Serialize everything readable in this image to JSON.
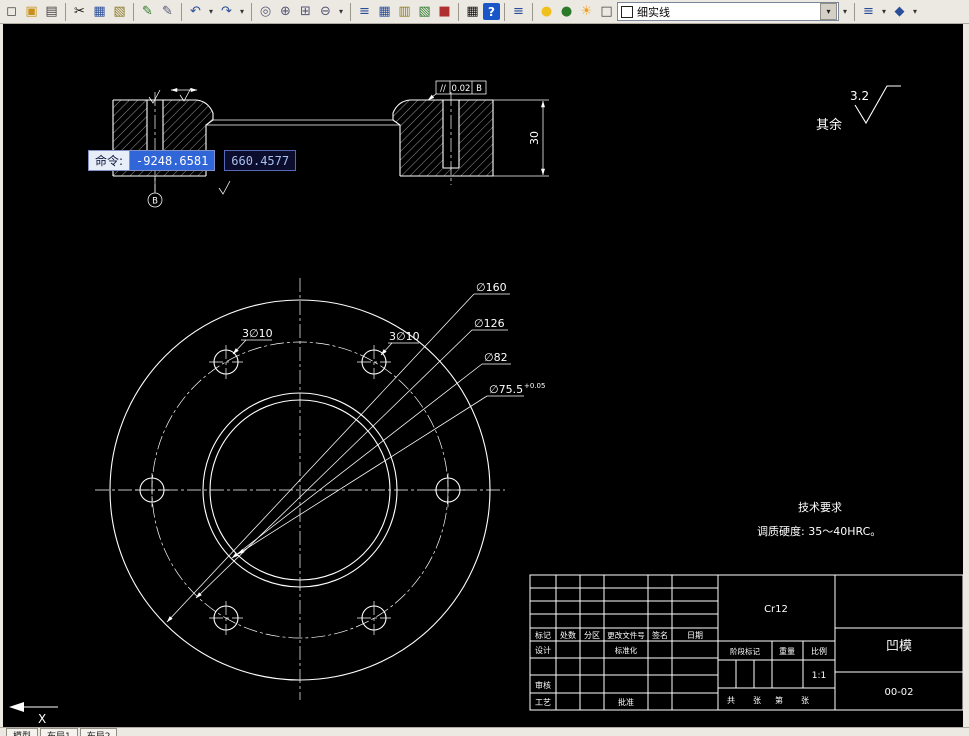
{
  "toolbar": {
    "linetype": "细实线",
    "glyphs": {
      "new": "◻",
      "open": "▣",
      "plot": "▤",
      "cut": "✂",
      "copy": "▦",
      "paste": "▧",
      "brush": "✎",
      "erase": "▨",
      "pencil": "✎",
      "undo": "↶",
      "redo": "↷",
      "caret": "▾",
      "pan": "◎",
      "zoom_in": "⊕",
      "zoom_window": "⊞",
      "zoom_prev": "⊖",
      "layers": "≡",
      "layer_props": "▦",
      "props": "▥",
      "design_center": "▧",
      "toolbox": "■",
      "table": "▦",
      "help": "?",
      "bulb": "●",
      "bulb2": "●",
      "sun": "☀",
      "square": "□",
      "stack": "≡",
      "publish": "◆"
    }
  },
  "command_overlay": {
    "label": "命令:",
    "x_value": "-9248.6581",
    "y_value": "660.4577"
  },
  "drawing": {
    "surface_note": {
      "value": "3.2",
      "rest": "其余"
    },
    "dims": {
      "d160": "∅160",
      "d126": "∅126",
      "d82": "∅82",
      "d755": "∅75.5",
      "d755_tol": "+0.05",
      "holes_left": "3∅10",
      "holes_right": "3∅10",
      "thickness": "30",
      "frame_symbol": "//",
      "frame_value": "0.02",
      "frame_datum": "B",
      "datum": "B"
    },
    "tech_req": {
      "title": "技术要求",
      "line1": "调质硬度: 35～40HRC。"
    },
    "ucs_label": "X"
  },
  "title_block": {
    "rev_headers": [
      "标记",
      "处数",
      "分区",
      "更改文件号",
      "签名",
      "日期"
    ],
    "design_label": "设计",
    "standardization_label": "标准化",
    "check_label": "审核",
    "process_label": "工艺",
    "approve_label": "批准",
    "stage_label": "阶段标记",
    "weight_label": "重量",
    "scale_label": "比例",
    "scale_value": "1:1",
    "sheet_text": [
      "共",
      "张",
      "第",
      "张"
    ],
    "material": "Cr12",
    "part_name": "凹模",
    "drawing_no": "00-02"
  },
  "tabs": {
    "model": "模型",
    "layout1": "布局1",
    "layout2": "布局2"
  }
}
